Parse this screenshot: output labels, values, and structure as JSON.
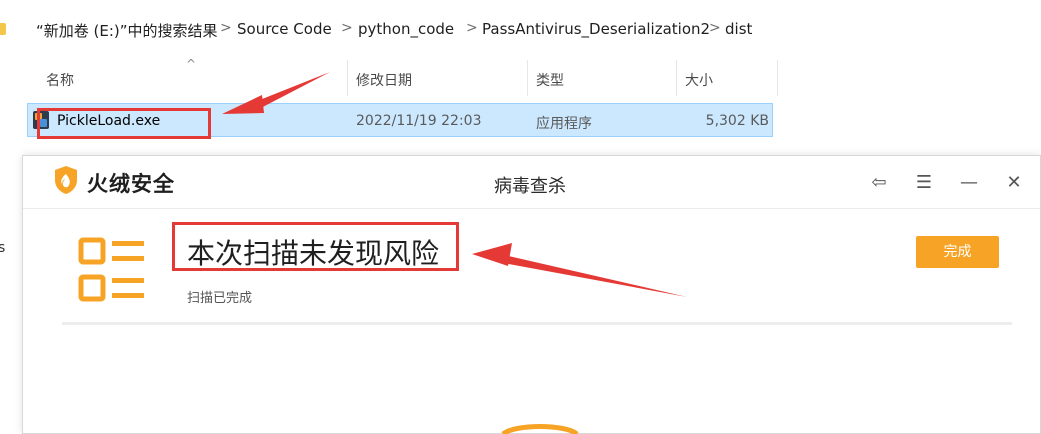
{
  "explorer": {
    "breadcrumb": [
      "“新加卷 (E:)”中的搜索结果",
      "Source Code",
      "python_code",
      "PassAntivirus_Deserialization2",
      "dist"
    ],
    "separator": ">",
    "columns": {
      "name": "名称",
      "modified": "修改日期",
      "type": "类型",
      "size": "大小"
    },
    "sort_indicator": "^",
    "file": {
      "name": "PickleLoad.exe",
      "modified": "2022/11/19 22:03",
      "type": "应用程序",
      "size": "5,302 KB"
    },
    "nav_pane_fragment": "s"
  },
  "dialog": {
    "brand": "火绒安全",
    "title": "病毒查杀",
    "controls": {
      "back": "⇦",
      "menu": "☰",
      "minimize": "—",
      "close": "✕"
    },
    "result_title": "本次扫描未发现风险",
    "result_subtitle": "扫描已完成",
    "done_label": "完成"
  },
  "colors": {
    "accent": "#f7a426",
    "annotation_red": "#e53935",
    "selection": "#cce8ff"
  }
}
